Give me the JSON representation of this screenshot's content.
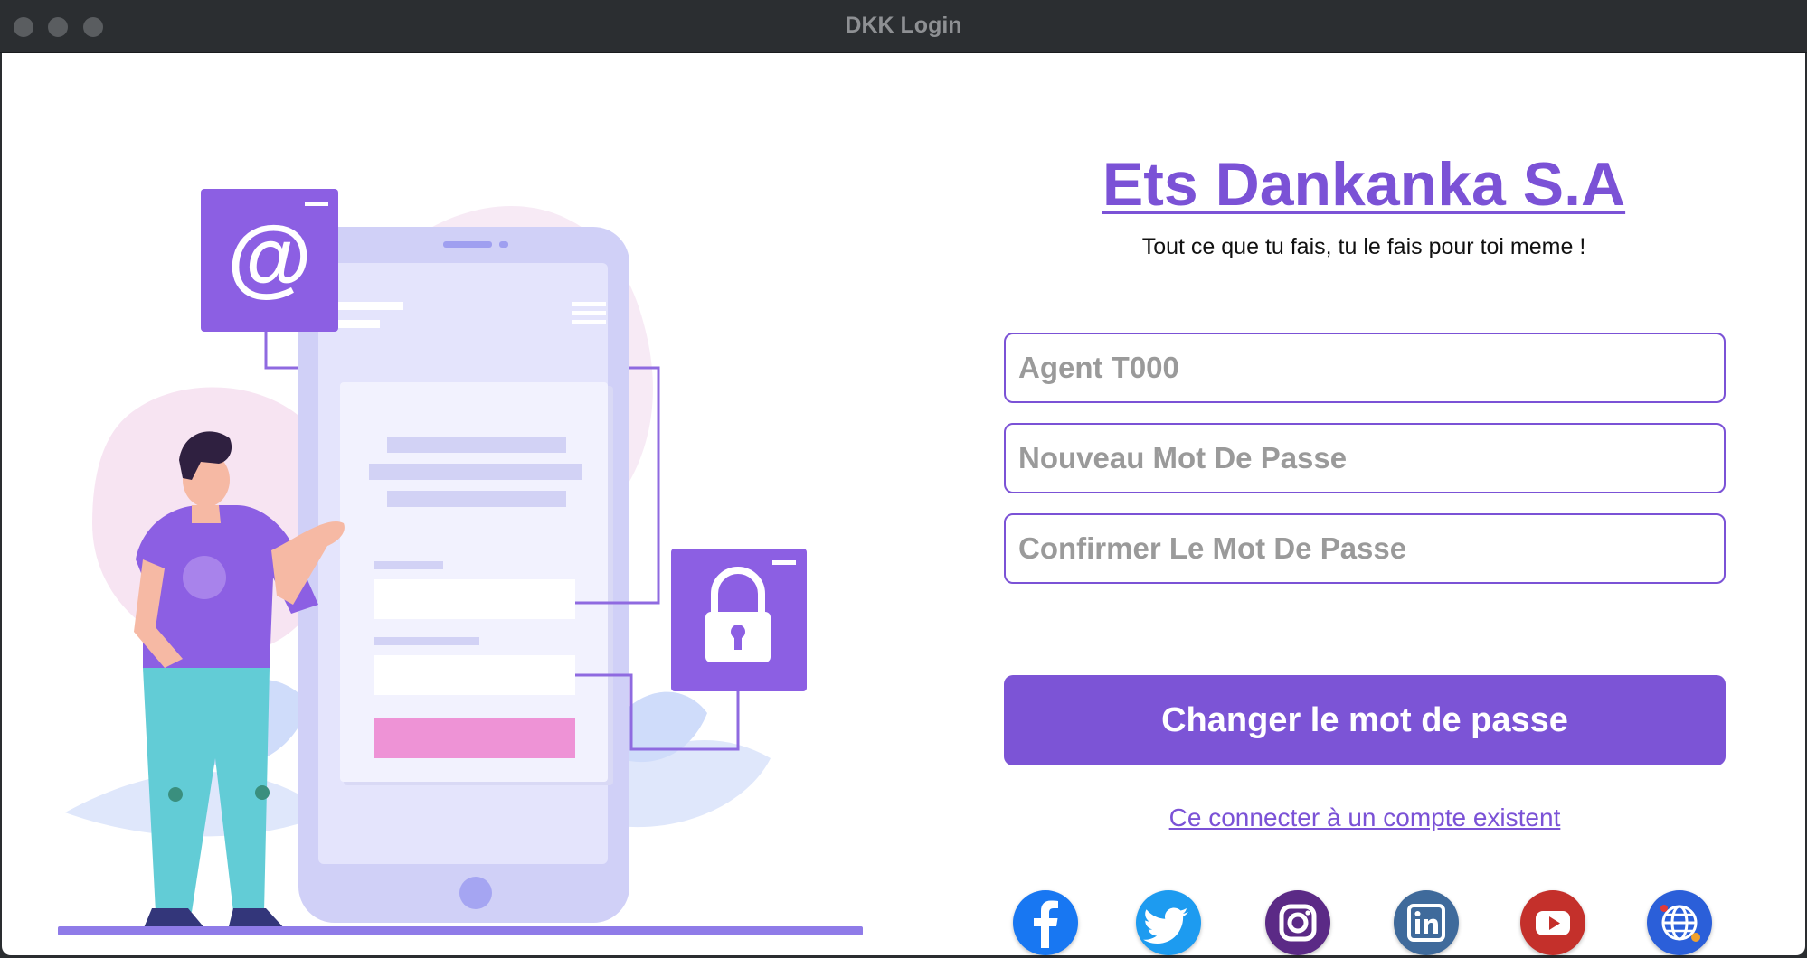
{
  "window": {
    "title": "DKK Login"
  },
  "brand": {
    "title": "Ets Dankanka S.A",
    "slogan": "Tout ce que tu fais, tu le fais pour toi meme !",
    "accent_color": "#7b52d6"
  },
  "form": {
    "username_placeholder": "Agent T000",
    "new_password_placeholder": "Nouveau Mot De Passe",
    "confirm_password_placeholder": "Confirmer Le Mot De Passe",
    "submit_label": "Changer le mot de passe",
    "login_link": "Ce connecter à un compte existent"
  },
  "social": [
    {
      "icon": "facebook-icon",
      "color": "#1877f2"
    },
    {
      "icon": "twitter-icon",
      "color": "#1d9bf0"
    },
    {
      "icon": "instagram-icon",
      "color": "#5b2a86"
    },
    {
      "icon": "linkedin-icon",
      "color": "#3f6a9b"
    },
    {
      "icon": "youtube-icon",
      "color": "#c4302b"
    },
    {
      "icon": "globe-icon",
      "color": "#2b5fd9"
    }
  ],
  "illustration": {
    "icon_email": "at-sign-icon",
    "icon_lock": "lock-icon"
  }
}
